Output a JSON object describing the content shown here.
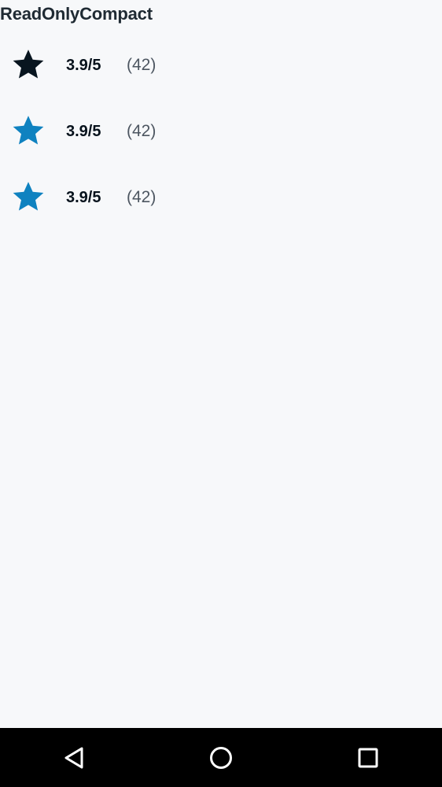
{
  "page": {
    "title": "ReadOnlyCompact"
  },
  "ratings": [
    {
      "rating": 3.9,
      "value_label": "3.9/5",
      "count_label": "(42)",
      "star_color": "#08151f"
    },
    {
      "rating": 3.9,
      "value_label": "3.9/5",
      "count_label": "(42)",
      "star_color": "#0f82c0"
    },
    {
      "rating": 3.9,
      "value_label": "3.9/5",
      "count_label": "(42)",
      "star_color": "#0f82c0"
    }
  ],
  "nav": {
    "back_icon": "triangle-back-icon",
    "home_icon": "circle-home-icon",
    "recents_icon": "square-recents-icon"
  },
  "colors": {
    "background": "#f7f8fa",
    "title_text": "#1f2a33",
    "value_text": "#07121c",
    "count_text": "#4d5661",
    "nav_background": "#000000"
  }
}
